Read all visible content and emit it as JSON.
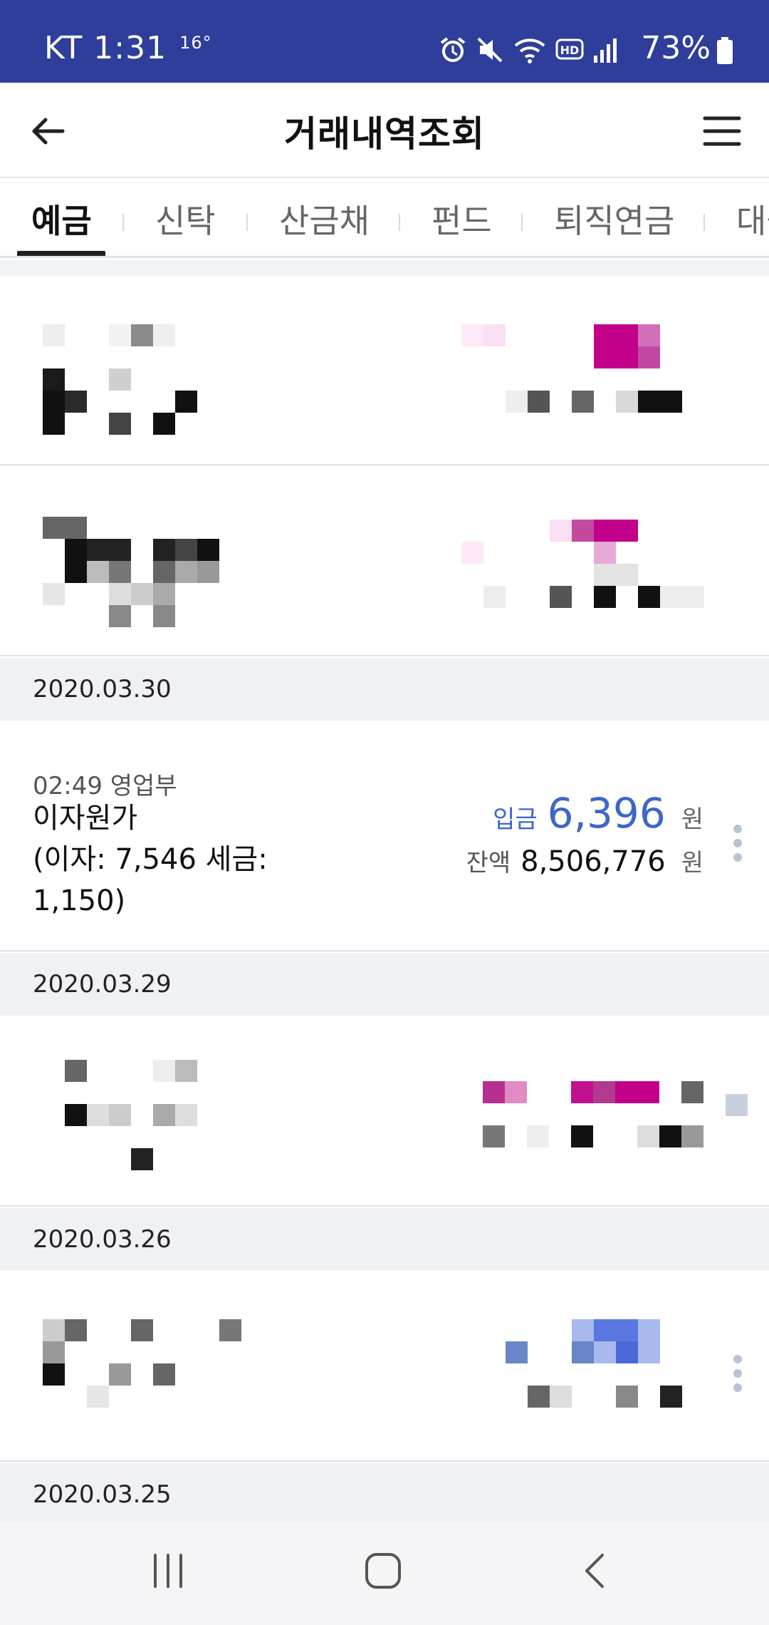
{
  "status_bar": {
    "carrier_time": "KT 1:31",
    "temperature": "16°",
    "battery": "73%"
  },
  "header": {
    "title": "거래내역조회"
  },
  "tabs": [
    {
      "label": "예금",
      "active": true
    },
    {
      "label": "신탁",
      "active": false
    },
    {
      "label": "산금채",
      "active": false
    },
    {
      "label": "펀드",
      "active": false
    },
    {
      "label": "퇴직연금",
      "active": false
    },
    {
      "label": "대출",
      "active": false
    }
  ],
  "dates": {
    "d1": "2020.03.30",
    "d2": "2020.03.29",
    "d3": "2020.03.26",
    "d4": "2020.03.25"
  },
  "transaction": {
    "time": "02:49 영업부",
    "description": "이자원가\n(이자: 7,546 세금:\n1,150)",
    "type_label": "입금",
    "amount": "6,396",
    "amount_unit": "원",
    "balance_label": "잔액",
    "balance": "8,506,776",
    "balance_unit": "원"
  },
  "colors": {
    "status_bar": "#2e3e9a",
    "accent_blue": "#3d66c9",
    "magenta": "#c2008a"
  }
}
